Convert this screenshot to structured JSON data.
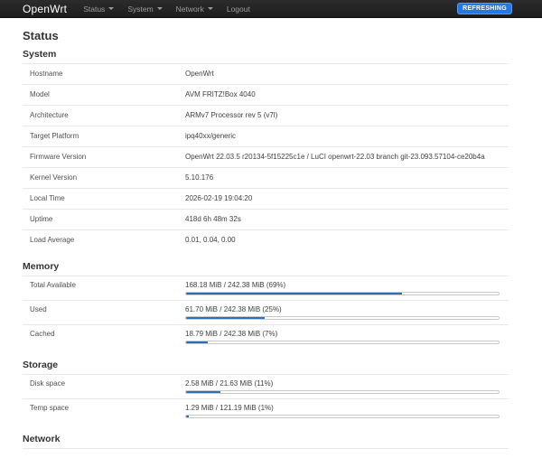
{
  "navbar": {
    "brand": "OpenWrt",
    "items": [
      {
        "label": "Status",
        "has_dropdown": true
      },
      {
        "label": "System",
        "has_dropdown": true
      },
      {
        "label": "Network",
        "has_dropdown": true
      },
      {
        "label": "Logout",
        "has_dropdown": false
      }
    ],
    "refresh_button": "REFRESHING"
  },
  "page": {
    "title": "Status"
  },
  "colors": {
    "navbar_bg": "#1d1d1d",
    "accent_button": "#2478e5",
    "bar_fill": "#2a70bc",
    "row_border": "#e8e8e8"
  },
  "sections": [
    {
      "title": "System",
      "rows": [
        {
          "label": "Hostname",
          "value": "OpenWrt"
        },
        {
          "label": "Model",
          "value": "AVM FRITZ!Box 4040"
        },
        {
          "label": "Architecture",
          "value": "ARMv7 Processor rev 5 (v7l)"
        },
        {
          "label": "Target Platform",
          "value": "ipq40xx/generic"
        },
        {
          "label": "Firmware Version",
          "value": "OpenWrt 22.03.5 r20134-5f15225c1e / LuCI openwrt-22.03 branch git-23.093.57104-ce20b4a"
        },
        {
          "label": "Kernel Version",
          "value": "5.10.176"
        },
        {
          "label": "Local Time",
          "value": "2026-02-19 19:04:20"
        },
        {
          "label": "Uptime",
          "value": "418d 6h 48m 32s"
        },
        {
          "label": "Load Average",
          "value": "0.01, 0.04, 0.00"
        }
      ]
    },
    {
      "title": "Memory",
      "bars": [
        {
          "label": "Total Available",
          "text": "168.18 MiB / 242.38 MiB (69%)",
          "percent": 69
        },
        {
          "label": "Used",
          "text": "61.70 MiB / 242.38 MiB (25%)",
          "percent": 25
        },
        {
          "label": "Cached",
          "text": "18.79 MiB / 242.38 MiB (7%)",
          "percent": 7
        }
      ]
    },
    {
      "title": "Storage",
      "bars": [
        {
          "label": "Disk space",
          "text": "2.58 MiB / 21.63 MiB (11%)",
          "percent": 11
        },
        {
          "label": "Temp space",
          "text": "1.29 MiB / 121.19 MiB (1%)",
          "percent": 1
        }
      ]
    },
    {
      "title": "Network"
    }
  ]
}
